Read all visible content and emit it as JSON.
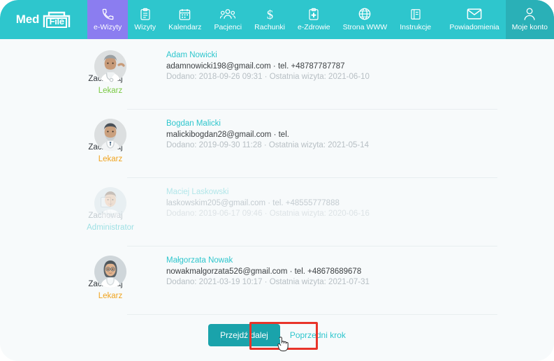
{
  "header": {
    "logo": {
      "med": "Med",
      "file": "File"
    },
    "nav_left": [
      {
        "label": "e-Wizyty",
        "icon": "phone-icon",
        "state": "active-purple"
      },
      {
        "label": "Wizyty",
        "icon": "clipboard-icon",
        "state": ""
      },
      {
        "label": "Kalendarz",
        "icon": "calendar-icon",
        "state": ""
      },
      {
        "label": "Pacjenci",
        "icon": "people-icon",
        "state": ""
      },
      {
        "label": "Rachunki",
        "icon": "dollar-icon",
        "state": ""
      },
      {
        "label": "e-Zdrowie",
        "icon": "medical-clipboard-icon",
        "state": ""
      },
      {
        "label": "Strona WWW",
        "icon": "globe-icon",
        "state": ""
      },
      {
        "label": "Instrukcje",
        "icon": "book-icon",
        "state": ""
      }
    ],
    "nav_right": [
      {
        "label": "Powiadomienia",
        "icon": "envelope-icon",
        "state": ""
      },
      {
        "label": "Moje konto",
        "icon": "user-icon",
        "state": "active-teal"
      }
    ]
  },
  "rows": [
    {
      "checked": true,
      "check_label": "Zachowaj",
      "role": "Lekarz",
      "role_color": "#7ac943",
      "name": "Adam Nowicki",
      "contact": "adamnowicki198@gmail.com · tel. +48787787787",
      "meta": "Dodano: 2018-09-26 09:31 · Ostatnia wizyta: 2021-06-10",
      "avatar": "doctor-grey-hair-avatar"
    },
    {
      "checked": true,
      "check_label": "Zachowaj",
      "role": "Lekarz",
      "role_color": "#f0a31e",
      "name": "Bogdan Malicki",
      "contact": "malickibogdan28@gmail.com · tel.",
      "meta": "Dodano: 2019-09-30 11:28 · Ostatnia wizyta: 2021-05-14",
      "avatar": "doctor-beard-avatar"
    },
    {
      "checked": false,
      "check_label": "Zachowaj",
      "role": "Administrator",
      "role_color": "#9fe0e4",
      "name": "Maciej Laskowski",
      "contact": "laskowskim205@gmail.com · tel. +48555777888",
      "meta": "Dodano: 2019-06-17 09:46 · Ostatnia wizyta: 2020-06-16",
      "avatar": "doctor-young-avatar"
    },
    {
      "checked": true,
      "check_label": "Zachowaj",
      "role": "Lekarz",
      "role_color": "#f0a31e",
      "name": "Małgorzata Nowak",
      "contact": "nowakmalgorzata526@gmail.com · tel. +48678689678",
      "meta": "Dodano: 2021-03-19 10:17 · Ostatnia wizyta: 2021-07-31",
      "avatar": "doctor-woman-avatar"
    }
  ],
  "footer": {
    "primary_label": "Przejdź dalej",
    "link_label": "Poprzedni krok"
  },
  "colors": {
    "header_bg": "#2ec6cd",
    "header_active": "#2ab0b7",
    "nav_highlight": "#8b7df0",
    "primary_button": "#1aa3ab",
    "link": "#2ec6cd",
    "checkbox": "#1877f2",
    "annotation": "#e8342a",
    "page_bg": "#f7fafb"
  }
}
